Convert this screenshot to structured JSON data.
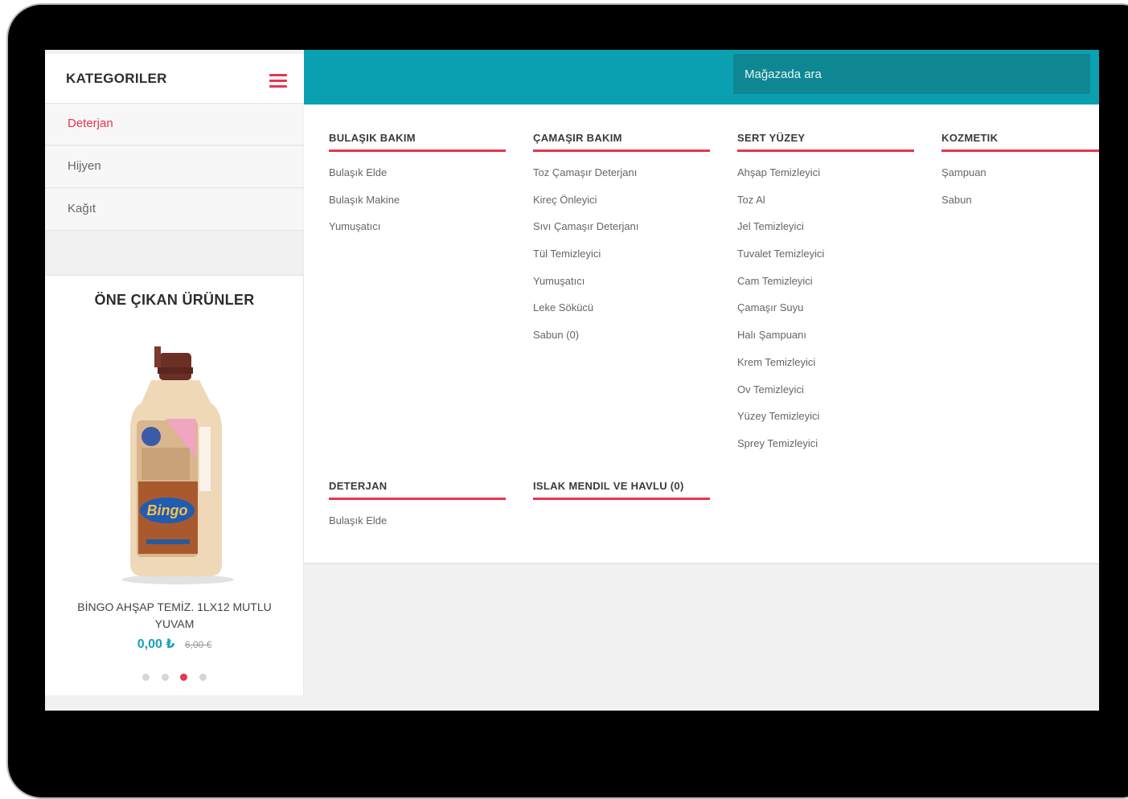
{
  "sidebar": {
    "title": "KATEGORILER",
    "categories": [
      {
        "label": "Deterjan",
        "active": true
      },
      {
        "label": "Hijyen",
        "active": false
      },
      {
        "label": "Kağıt",
        "active": false
      }
    ]
  },
  "featured": {
    "title": "ÖNE ÇIKAN ÜRÜNLER",
    "product": {
      "name": "BİNGO AHŞAP TEMİZ. 1LX12 MUTLU YUVAM",
      "price": "0,00 ₺",
      "old_price": "6,00 €",
      "image_brand": "Bingo"
    },
    "carousel": {
      "count": 4,
      "active_index": 2
    }
  },
  "search": {
    "placeholder": "Mağazada ara"
  },
  "menu": {
    "columns": [
      {
        "heading": "BULAŞIK BAKIM",
        "links": [
          "Bulaşık Elde",
          "Bulaşık Makine",
          "Yumuşatıcı"
        ]
      },
      {
        "heading": "ÇAMAŞIR BAKIM",
        "links": [
          "Toz Çamaşır Deterjanı",
          "Kireç Önleyici",
          "Sıvı Çamaşır Deterjanı",
          "Tül Temizleyici",
          "Yumuşatıcı",
          "Leke Sökücü",
          "Sabun (0)"
        ]
      },
      {
        "heading": "SERT YÜZEY",
        "links": [
          "Ahşap Temizleyici",
          "Toz Al",
          "Jel Temizleyici",
          "Tuvalet Temizleyici",
          "Cam Temizleyici",
          "Çamaşır Suyu",
          "Halı Şampuanı",
          "Krem Temizleyici",
          "Ov Temizleyici",
          "Yüzey Temizleyici",
          "Sprey Temizleyici"
        ]
      },
      {
        "heading": "KOZMETIK",
        "links": [
          "Şampuan",
          "Sabun"
        ]
      },
      {
        "heading": "DETERJAN",
        "links": [
          "Bulaşık Elde"
        ]
      },
      {
        "heading": "ISLAK MENDIL VE HAVLU (0)",
        "links": []
      }
    ]
  },
  "colors": {
    "accent": "#e8344e",
    "teal": "#0aa0b2",
    "search_bg": "#0f8792",
    "price": "#1aa2b6"
  }
}
